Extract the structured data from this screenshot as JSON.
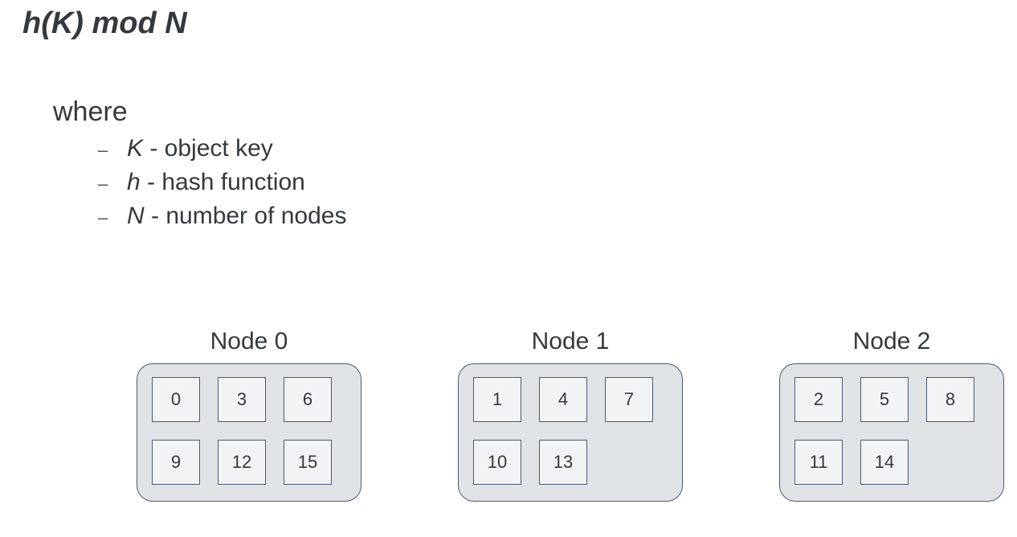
{
  "title": "h(K) mod N",
  "where_label": "where",
  "definitions": [
    {
      "symbol": "K",
      "desc": " - object key"
    },
    {
      "symbol": "h",
      "desc": " - hash function"
    },
    {
      "symbol": "N",
      "desc": " - number of nodes"
    }
  ],
  "nodes": [
    {
      "label": "Node 0",
      "cells": [
        "0",
        "3",
        "6",
        "9",
        "12",
        "15"
      ]
    },
    {
      "label": "Node 1",
      "cells": [
        "1",
        "4",
        "7",
        "10",
        "13",
        ""
      ]
    },
    {
      "label": "Node 2",
      "cells": [
        "2",
        "5",
        "8",
        "11",
        "14",
        ""
      ]
    }
  ]
}
